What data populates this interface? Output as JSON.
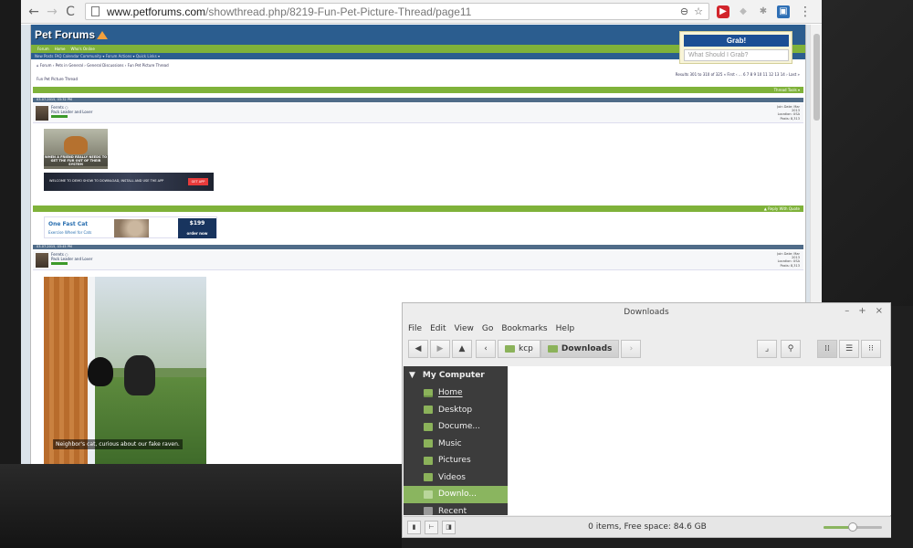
{
  "browser": {
    "url_domain": "www.petforums.com",
    "url_path": "/showthread.php/8219-Fun-Pet-Picture-Thread/page11",
    "nav": {
      "back_icon": "←",
      "forward_icon": "→",
      "reload_icon": "C"
    },
    "omnibox_icons": {
      "zoom": "⊖",
      "star": "☆"
    },
    "extensions": [
      "youtube-icon",
      "ghost-extension-icon",
      "puzzle-icon",
      "screenshot-extension-icon"
    ],
    "menu_icon": "⋮"
  },
  "forum": {
    "logo": "Pet Forums",
    "tabs": [
      "Forum",
      "Home",
      "Who's Online"
    ],
    "subnav": "New Posts  FAQ  Calendar  Community ▾  Forum Actions ▾  Quick Links ▾",
    "breadcrumb": "⌂ Forum › Pets in General › General Discussions › Fun Pet Picture Thread",
    "thread_title": "Fun Pet Picture Thread",
    "pagination": "Results 301 to 310 of 325  « First ‹ ... 6 7 8 9 10 11 12 13 14 › Last »",
    "green_bar_text": "Thread Tools ▾",
    "post1": {
      "date": "03-07-2015, 03:32 PM",
      "user": "Ferrets ○",
      "rank": "Pack Leader and Lover",
      "stats": [
        "Join Date: Mar",
        "2013",
        "Location: USA",
        "Posts: 8,313"
      ],
      "image_caption": "WHEN A FRIEND REALLY NEEDS TO GET THE FUR OUT OF THEIR SYSTEM"
    },
    "ad_strip": {
      "text": "WELCOME TO DEMO SHOW TO DOWNLOAD, INSTALL AND USE THE APP",
      "button": "GET APP"
    },
    "bar2_text": "▲ Reply With Quote",
    "banner": {
      "logo": "One Fast Cat",
      "sub": "Exercise Wheel for Cats",
      "price": "$199",
      "price_sub": "order now"
    },
    "post2": {
      "date": "03-07-2015, 03:45 PM",
      "user": "Ferrets ○",
      "rank": "Pack Leader and Lover",
      "stats": [
        "Join Date: Mar",
        "2013",
        "Location: USA",
        "Posts: 8,313"
      ],
      "image_caption": "Neighbor's cat, curious about our fake raven."
    }
  },
  "grab_popup": {
    "button": "Grab!",
    "placeholder": "What Should I Grab?"
  },
  "file_manager": {
    "title": "Downloads",
    "window_buttons": {
      "minimize": "–",
      "maximize": "+",
      "close": "×"
    },
    "menu": [
      "File",
      "Edit",
      "View",
      "Go",
      "Bookmarks",
      "Help"
    ],
    "toolbar": {
      "back_icon": "◀",
      "forward_icon": "▶",
      "up_icon": "▲",
      "prev_crumb_icon": "‹",
      "next_crumb_icon": "›",
      "crumbs": [
        "kcp",
        "Downloads"
      ],
      "terminal_icon": "⌟",
      "search_icon": "🔍",
      "view_icons": [
        "⁞⁞",
        "☰",
        "⁝⁝"
      ]
    },
    "sidebar": {
      "section": "My Computer",
      "items": [
        {
          "label": "Home",
          "icon": "home-icon"
        },
        {
          "label": "Desktop",
          "icon": "desktop-icon"
        },
        {
          "label": "Docume...",
          "icon": "documents-icon"
        },
        {
          "label": "Music",
          "icon": "music-icon"
        },
        {
          "label": "Pictures",
          "icon": "pictures-icon"
        },
        {
          "label": "Videos",
          "icon": "videos-icon"
        },
        {
          "label": "Downlo...",
          "icon": "downloads-icon"
        },
        {
          "label": "Recent",
          "icon": "recent-icon"
        }
      ],
      "selected": "Downlo..."
    },
    "status": {
      "text": "0 items, Free space: 84.6 GB",
      "zoom_level": 0.5
    },
    "accent_color": "#8ab55f"
  }
}
